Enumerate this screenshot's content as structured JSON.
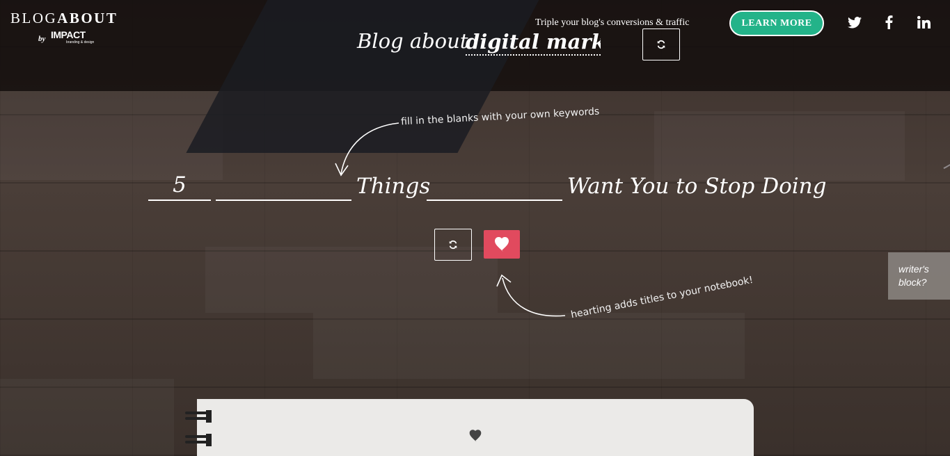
{
  "header": {
    "logo_text_regular": "BLOG",
    "logo_text_bold": "ABOUT",
    "logo_by": "by",
    "logo_brand": "IMPACT",
    "logo_brand_sub": "branding & design",
    "promo_text": "Triple your blog's conversions & traffic",
    "learn_more_label": "LEARN MORE",
    "social_icons": [
      "twitter-icon",
      "facebook-icon",
      "linkedin-icon"
    ]
  },
  "topic_bar": {
    "prefix": "Blog about",
    "topic": "digital marketing"
  },
  "hints": {
    "fill_blanks": "fill in the blanks with your own keywords",
    "hearting": "hearting adds titles to your notebook!"
  },
  "title": {
    "blank_1_value": "5",
    "blank_2_value": "",
    "word_1": "Things",
    "blank_3_value": "",
    "word_2": "Want You to Stop Doing"
  },
  "writers_block": {
    "line_1": "writer's",
    "line_2": "block?"
  },
  "colors": {
    "accent_green": "#23b389",
    "heart_red": "#e14a5e"
  }
}
